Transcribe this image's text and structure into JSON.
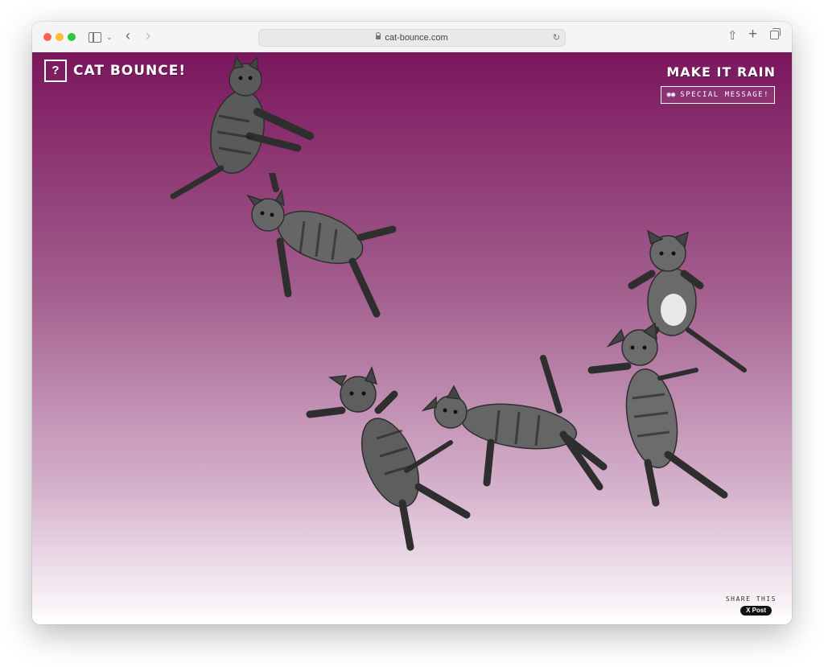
{
  "browser": {
    "url": "cat-bounce.com"
  },
  "header": {
    "help_label": "?",
    "logo_text": "CAT BOUNCE!",
    "make_it_rain_label": "MAKE IT RAIN",
    "special_message_label": "SPECIAL MESSAGE!"
  },
  "footer": {
    "share_label": "SHARE THIS",
    "post_label": "X Post"
  },
  "colors": {
    "gradient_top": "#7b165d",
    "gradient_bottom": "#ffffff"
  },
  "cats": [
    {
      "name": "cat-1"
    },
    {
      "name": "cat-2"
    },
    {
      "name": "cat-3"
    },
    {
      "name": "cat-4"
    },
    {
      "name": "cat-5"
    },
    {
      "name": "cat-6"
    }
  ]
}
